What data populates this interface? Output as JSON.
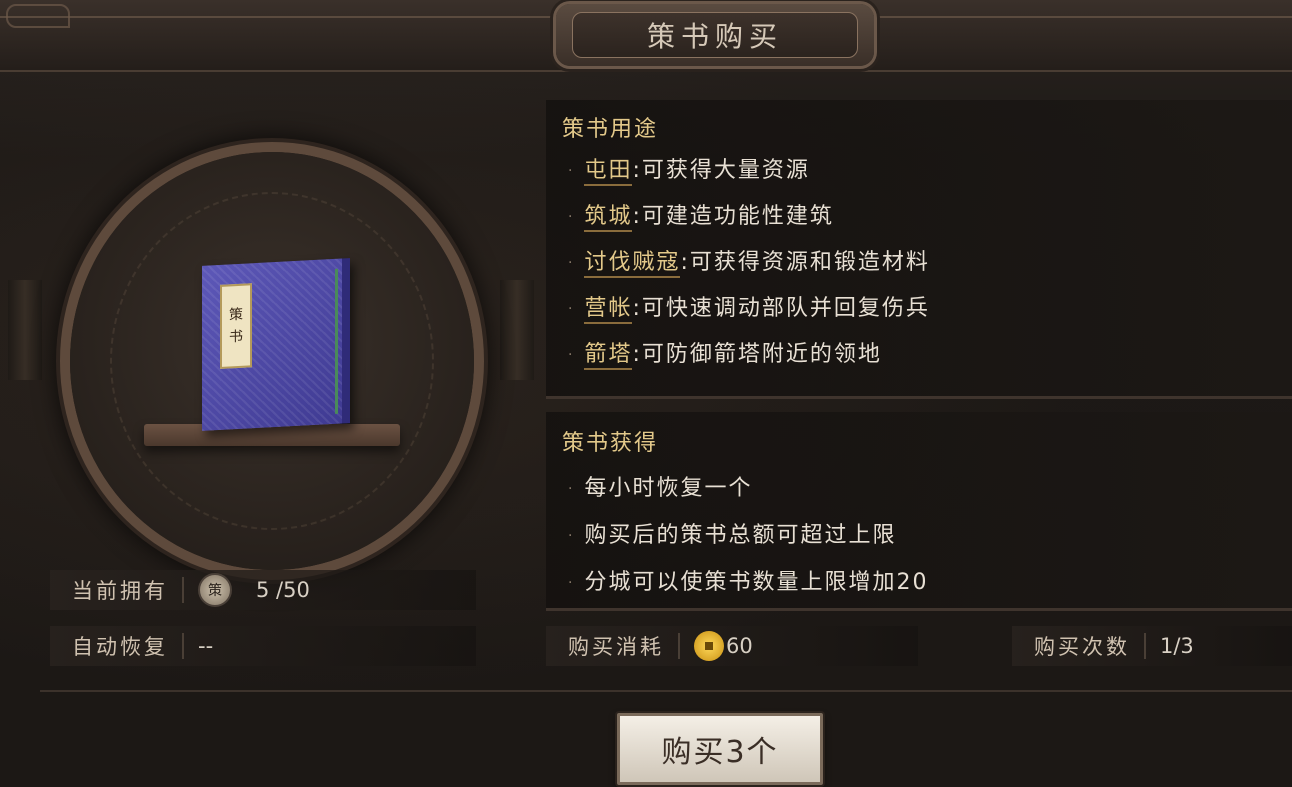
{
  "title": "策书购买",
  "book": {
    "label_chars": [
      "策",
      "书"
    ]
  },
  "usage": {
    "heading": "策书用途",
    "bullet": "·",
    "items": [
      {
        "term": "屯田",
        "desc": ":可获得大量资源"
      },
      {
        "term": "筑城",
        "desc": ":可建造功能性建筑"
      },
      {
        "term": "讨伐贼寇",
        "desc": ":可获得资源和锻造材料"
      },
      {
        "term": "营帐",
        "desc": ":可快速调动部队并回复伤兵"
      },
      {
        "term": "箭塔",
        "desc": ":可防御箭塔附近的领地"
      }
    ]
  },
  "obtain": {
    "heading": "策书获得",
    "items": [
      "每小时恢复一个",
      "购买后的策书总额可超过上限",
      "分城可以使策书数量上限增加20"
    ]
  },
  "stats": {
    "own_label": "当前拥有",
    "own_icon_char": "策",
    "own_value": "5 /50",
    "recover_label": "自动恢复",
    "recover_value": "--",
    "cost_label": "购买消耗",
    "cost_value": "60",
    "count_label": "购买次数",
    "count_value": "1/3"
  },
  "buy_button_label": "购买3个",
  "icons": {
    "token": "ce-token-icon",
    "coin": "copper-coin-icon"
  },
  "colors": {
    "accent_gold": "#e3c98a",
    "book_blue": "#4a45a8",
    "coin_gold": "#f2c230"
  }
}
